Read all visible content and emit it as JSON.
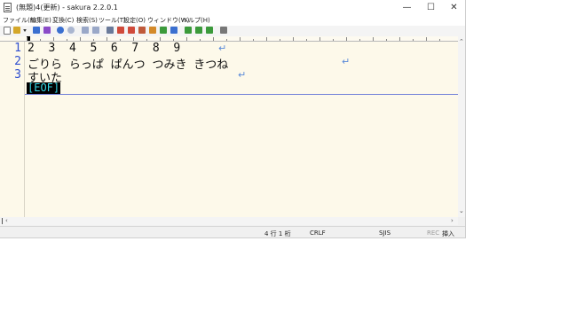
{
  "window": {
    "title": "(無題)4(更新) - sakura 2.2.0.1"
  },
  "window_controls": {
    "minimize": "—",
    "maximize": "☐",
    "close": "✕"
  },
  "menu": [
    "ファイル(F)",
    "編集(E)",
    "変換(C)",
    "検索(S)",
    "ツール(T)",
    "設定(O)",
    "ウィンドウ(W)",
    "ヘルプ(H)"
  ],
  "toolbar": {
    "icons": [
      "new-file-icon",
      "open-file-icon",
      "open-dropdown-icon",
      "save-icon",
      "save-as-icon",
      "undo-icon",
      "redo-icon",
      "back-icon",
      "forward-icon",
      "search-icon",
      "search-prev-icon",
      "search-next-icon",
      "replace-icon",
      "mark-icon",
      "grep-icon",
      "jump-icon",
      "copy-icon",
      "paste-icon",
      "cut-icon",
      "settings-icon"
    ],
    "colors": {
      "blue": "#3a6fd0",
      "red": "#d04a3a",
      "green": "#3b9a3b",
      "gray": "#777777",
      "orange": "#d48a2a"
    }
  },
  "editor": {
    "line_numbers": [
      "1",
      "2",
      "3"
    ],
    "lines": [
      "2  3  4  5  6  7  8  9",
      "ごりら らっぱ ぱんつ つみき きつね",
      "すいた"
    ],
    "eof": "[EOF]",
    "colors": {
      "background": "#fdf9ea",
      "line_number": "#2f4fcf",
      "return_mark": "#5a8ad9",
      "eof_fg": "#35d6e6",
      "eof_bg": "#000000"
    }
  },
  "status": {
    "position": "4 行  1 桁",
    "line_ending": "CRLF",
    "encoding": "SJIS",
    "rec": "REC",
    "insert": "挿入"
  }
}
